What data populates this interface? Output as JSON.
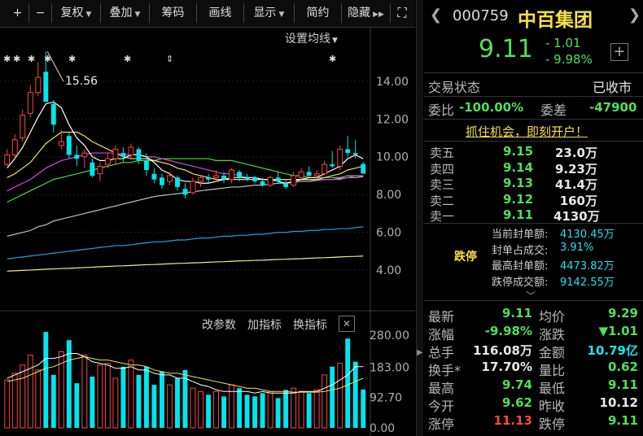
{
  "toolbar": {
    "plus": "+",
    "minus": "−",
    "fuquan": "复权",
    "diejia": "叠加",
    "chouma": "筹码",
    "huaxian": "画线",
    "xianshi": "显示",
    "jianyue": "简约",
    "yincang": "隐藏",
    "fullscreen": "⛶"
  },
  "chart": {
    "ma_settings": "设置均线",
    "high_label": "15.56",
    "y_ticks": [
      "14.00",
      "12.00",
      "10.00",
      "8.00",
      "6.00",
      "4.00"
    ],
    "vol_ticks": [
      "280.00",
      "183.00",
      "92.70",
      "0.00"
    ],
    "vol_buttons": {
      "params": "改参数",
      "add": "加指标",
      "switch": "换指标",
      "close": "✕"
    },
    "colors": {
      "up": "#ff4545",
      "down": "#00e5ee",
      "ma5": "#ffffff",
      "ma10": "#f0e060",
      "ma20": "#e040e0",
      "ma30": "#40e040",
      "ma60": "#c0c0c0",
      "ma120": "#20a0e0",
      "ma250": "#f0f080"
    }
  },
  "chart_data": {
    "type": "candlestick",
    "ylim": [
      2.2,
      16.4
    ],
    "vol_ylim": [
      0,
      300
    ],
    "candles": [
      {
        "o": 9.6,
        "h": 10.4,
        "l": 9.5,
        "c": 10.1,
        "v": 145
      },
      {
        "o": 10.1,
        "h": 11.2,
        "l": 9.9,
        "c": 10.9,
        "v": 165
      },
      {
        "o": 11.0,
        "h": 12.5,
        "l": 10.8,
        "c": 12.2,
        "v": 190
      },
      {
        "o": 12.3,
        "h": 13.8,
        "l": 12.1,
        "c": 13.4,
        "v": 220
      },
      {
        "o": 13.4,
        "h": 15.0,
        "l": 13.2,
        "c": 14.2,
        "v": 175
      },
      {
        "o": 14.5,
        "h": 15.56,
        "l": 13.1,
        "c": 12.9,
        "v": 290
      },
      {
        "o": 12.8,
        "h": 13.0,
        "l": 11.3,
        "c": 11.7,
        "v": 160
      },
      {
        "o": 10.6,
        "h": 11.4,
        "l": 10.4,
        "c": 10.8,
        "v": 230
      },
      {
        "o": 11.1,
        "h": 11.3,
        "l": 9.9,
        "c": 10.1,
        "v": 265
      },
      {
        "o": 10.1,
        "h": 10.6,
        "l": 9.5,
        "c": 9.9,
        "v": 135
      },
      {
        "o": 10.0,
        "h": 10.4,
        "l": 9.4,
        "c": 10.2,
        "v": 220
      },
      {
        "o": 9.7,
        "h": 9.9,
        "l": 8.9,
        "c": 9.0,
        "v": 155
      },
      {
        "o": 9.1,
        "h": 9.7,
        "l": 8.7,
        "c": 9.5,
        "v": 190
      },
      {
        "o": 9.6,
        "h": 10.2,
        "l": 9.4,
        "c": 9.9,
        "v": 195
      },
      {
        "o": 9.9,
        "h": 10.6,
        "l": 9.6,
        "c": 10.4,
        "v": 150
      },
      {
        "o": 10.2,
        "h": 10.5,
        "l": 9.7,
        "c": 10.0,
        "v": 185
      },
      {
        "o": 10.1,
        "h": 10.7,
        "l": 9.9,
        "c": 10.5,
        "v": 205
      },
      {
        "o": 10.4,
        "h": 10.5,
        "l": 9.6,
        "c": 9.8,
        "v": 160
      },
      {
        "o": 9.8,
        "h": 10.2,
        "l": 9.0,
        "c": 9.3,
        "v": 185
      },
      {
        "o": 9.1,
        "h": 9.4,
        "l": 8.6,
        "c": 8.8,
        "v": 130
      },
      {
        "o": 8.9,
        "h": 9.1,
        "l": 8.3,
        "c": 8.5,
        "v": 170
      },
      {
        "o": 8.7,
        "h": 9.2,
        "l": 8.5,
        "c": 9.0,
        "v": 130
      },
      {
        "o": 8.9,
        "h": 9.0,
        "l": 8.2,
        "c": 8.4,
        "v": 150
      },
      {
        "o": 8.3,
        "h": 8.6,
        "l": 7.8,
        "c": 8.0,
        "v": 175
      },
      {
        "o": 8.1,
        "h": 8.9,
        "l": 8.0,
        "c": 8.7,
        "v": 120
      },
      {
        "o": 8.7,
        "h": 9.0,
        "l": 8.4,
        "c": 8.9,
        "v": 110
      },
      {
        "o": 8.9,
        "h": 9.1,
        "l": 8.6,
        "c": 8.8,
        "v": 100
      },
      {
        "o": 8.9,
        "h": 9.3,
        "l": 8.7,
        "c": 9.0,
        "v": 110
      },
      {
        "o": 9.0,
        "h": 9.2,
        "l": 8.6,
        "c": 8.8,
        "v": 95
      },
      {
        "o": 8.8,
        "h": 9.4,
        "l": 8.6,
        "c": 9.3,
        "v": 130
      },
      {
        "o": 9.2,
        "h": 9.3,
        "l": 8.7,
        "c": 8.9,
        "v": 120
      },
      {
        "o": 8.9,
        "h": 9.1,
        "l": 8.7,
        "c": 8.8,
        "v": 100
      },
      {
        "o": 8.9,
        "h": 9.0,
        "l": 8.6,
        "c": 8.7,
        "v": 95
      },
      {
        "o": 8.7,
        "h": 8.9,
        "l": 8.4,
        "c": 8.5,
        "v": 105
      },
      {
        "o": 8.5,
        "h": 9.0,
        "l": 8.4,
        "c": 8.9,
        "v": 110
      },
      {
        "o": 8.9,
        "h": 9.2,
        "l": 8.6,
        "c": 8.7,
        "v": 90
      },
      {
        "o": 8.6,
        "h": 8.8,
        "l": 8.3,
        "c": 8.4,
        "v": 115
      },
      {
        "o": 8.5,
        "h": 9.2,
        "l": 8.4,
        "c": 9.0,
        "v": 120
      },
      {
        "o": 8.9,
        "h": 9.4,
        "l": 8.8,
        "c": 9.2,
        "v": 110
      },
      {
        "o": 9.2,
        "h": 9.5,
        "l": 8.9,
        "c": 9.0,
        "v": 105
      },
      {
        "o": 9.0,
        "h": 9.3,
        "l": 8.8,
        "c": 9.1,
        "v": 115
      },
      {
        "o": 9.1,
        "h": 9.8,
        "l": 9.0,
        "c": 9.6,
        "v": 160
      },
      {
        "o": 9.6,
        "h": 10.3,
        "l": 9.4,
        "c": 9.5,
        "v": 185
      },
      {
        "o": 9.5,
        "h": 10.6,
        "l": 9.3,
        "c": 10.4,
        "v": 195
      },
      {
        "o": 10.4,
        "h": 11.1,
        "l": 10.0,
        "c": 10.2,
        "v": 270
      },
      {
        "o": 10.2,
        "h": 10.9,
        "l": 9.9,
        "c": 10.12,
        "v": 200
      },
      {
        "o": 9.62,
        "h": 9.74,
        "l": 9.11,
        "c": 9.11,
        "v": 116
      }
    ],
    "ma5": [
      9.4,
      9.9,
      10.5,
      11.3,
      12.1,
      12.8,
      12.9,
      12.6,
      11.7,
      11.0,
      10.6,
      10.0,
      9.8,
      9.8,
      9.9,
      9.9,
      10.1,
      10.1,
      10.0,
      9.7,
      9.3,
      9.1,
      8.8,
      8.7,
      8.7,
      8.6,
      8.6,
      8.7,
      8.8,
      8.9,
      8.9,
      8.9,
      8.9,
      8.8,
      8.8,
      8.7,
      8.6,
      8.7,
      8.8,
      8.9,
      8.9,
      9.1,
      9.3,
      9.5,
      9.9,
      10.1,
      9.9
    ],
    "ma10": [
      8.9,
      9.1,
      9.4,
      9.7,
      10.2,
      10.7,
      11.0,
      11.3,
      11.3,
      11.3,
      11.1,
      10.8,
      10.6,
      10.4,
      10.2,
      10.0,
      9.9,
      9.9,
      9.9,
      9.8,
      9.7,
      9.6,
      9.4,
      9.3,
      9.1,
      9.0,
      8.9,
      8.8,
      8.8,
      8.8,
      8.8,
      8.8,
      8.8,
      8.8,
      8.8,
      8.8,
      8.8,
      8.8,
      8.8,
      8.8,
      8.8,
      8.9,
      9.0,
      9.1,
      9.3,
      9.4,
      9.5
    ],
    "ma20": [
      8.2,
      8.4,
      8.6,
      8.8,
      9.1,
      9.4,
      9.6,
      9.8,
      9.9,
      10.0,
      10.1,
      10.2,
      10.2,
      10.2,
      10.2,
      10.1,
      10.1,
      10.1,
      10.0,
      10.0,
      9.9,
      9.8,
      9.7,
      9.6,
      9.5,
      9.4,
      9.3,
      9.2,
      9.1,
      9.1,
      9.0,
      8.9,
      8.9,
      8.8,
      8.8,
      8.8,
      8.8,
      8.8,
      8.8,
      8.8,
      8.8,
      8.8,
      8.8,
      8.8,
      8.9,
      9.0,
      9.0
    ],
    "ma30": [
      7.6,
      7.8,
      8.0,
      8.2,
      8.4,
      8.6,
      8.8,
      8.9,
      9.0,
      9.1,
      9.2,
      9.3,
      9.4,
      9.5,
      9.6,
      9.7,
      9.7,
      9.8,
      9.8,
      9.8,
      9.9,
      9.9,
      9.9,
      9.9,
      9.9,
      9.9,
      9.9,
      9.8,
      9.8,
      9.8,
      9.7,
      9.6,
      9.5,
      9.4,
      9.3,
      9.2,
      9.1,
      9.0,
      9.0,
      8.9,
      8.9,
      8.9,
      8.9,
      8.9,
      9.0,
      9.0,
      9.0
    ],
    "ma60": [
      5.8,
      5.9,
      6.0,
      6.1,
      6.3,
      6.4,
      6.6,
      6.7,
      6.8,
      6.9,
      7.0,
      7.1,
      7.2,
      7.3,
      7.4,
      7.5,
      7.6,
      7.7,
      7.8,
      7.9,
      7.95,
      8.0,
      8.05,
      8.1,
      8.15,
      8.2,
      8.25,
      8.3,
      8.35,
      8.4,
      8.4,
      8.45,
      8.5,
      8.5,
      8.55,
      8.6,
      8.6,
      8.65,
      8.7,
      8.7,
      8.75,
      8.8,
      8.8,
      8.85,
      8.9,
      8.9,
      8.95
    ],
    "ma120": [
      4.6,
      4.65,
      4.7,
      4.75,
      4.8,
      4.85,
      4.9,
      4.95,
      5.0,
      5.05,
      5.1,
      5.15,
      5.2,
      5.25,
      5.3,
      5.3,
      5.35,
      5.4,
      5.45,
      5.5,
      5.5,
      5.55,
      5.6,
      5.6,
      5.65,
      5.7,
      5.7,
      5.75,
      5.8,
      5.8,
      5.85,
      5.85,
      5.9,
      5.9,
      5.95,
      6.0,
      6.0,
      6.05,
      6.05,
      6.1,
      6.1,
      6.15,
      6.15,
      6.2,
      6.2,
      6.25,
      6.3
    ],
    "ma250": [
      3.95,
      3.97,
      3.99,
      4.01,
      4.03,
      4.05,
      4.07,
      4.09,
      4.1,
      4.12,
      4.14,
      4.16,
      4.18,
      4.2,
      4.22,
      4.23,
      4.25,
      4.27,
      4.29,
      4.3,
      4.32,
      4.34,
      4.36,
      4.37,
      4.39,
      4.4,
      4.42,
      4.44,
      4.45,
      4.47,
      4.49,
      4.5,
      4.52,
      4.53,
      4.55,
      4.57,
      4.58,
      4.6,
      4.61,
      4.63,
      4.65,
      4.66,
      4.68,
      4.7,
      4.72,
      4.73,
      4.75
    ],
    "vol_ma5": [
      150,
      160,
      170,
      180,
      190,
      210,
      210,
      215,
      225,
      225,
      215,
      200,
      195,
      190,
      180,
      180,
      185,
      175,
      175,
      165,
      160,
      160,
      150,
      150,
      140,
      130,
      125,
      115,
      110,
      110,
      110,
      110,
      105,
      110,
      105,
      105,
      105,
      105,
      110,
      110,
      110,
      120,
      130,
      145,
      160,
      185,
      185
    ],
    "vol_ma10": [
      140,
      145,
      150,
      160,
      170,
      180,
      185,
      195,
      205,
      210,
      215,
      210,
      205,
      205,
      200,
      195,
      190,
      190,
      185,
      175,
      170,
      165,
      165,
      160,
      155,
      150,
      145,
      140,
      135,
      130,
      125,
      120,
      120,
      115,
      110,
      110,
      110,
      108,
      108,
      108,
      108,
      110,
      115,
      120,
      130,
      140,
      150
    ]
  },
  "quote": {
    "code": "000759",
    "name": "中百集团",
    "price": "9.11",
    "change": "- 1.01",
    "pct": "- 9.98%",
    "add": "+",
    "status_label": "交易状态",
    "status_value": "已收市",
    "weibi_label": "委比",
    "weibi_value": "-100.00%",
    "weicha_label": "委差",
    "weicha_value": "-47900",
    "promo": "抓住机会，即刻开户！",
    "asks": [
      {
        "label": "卖五",
        "price": "9.15",
        "vol": "23.0万"
      },
      {
        "label": "卖四",
        "price": "9.14",
        "vol": "9.23万"
      },
      {
        "label": "卖三",
        "price": "9.13",
        "vol": "41.4万"
      },
      {
        "label": "卖二",
        "price": "9.12",
        "vol": "160万"
      },
      {
        "label": "卖一",
        "price": "9.11",
        "vol": "4130万"
      }
    ],
    "limit_tag": "跌停",
    "limit_lines": [
      {
        "label": "当前封单额:",
        "value": "4130.45万"
      },
      {
        "label": "封单占成交:",
        "value": "3.91%"
      },
      {
        "label": "最高封单额:",
        "value": "4473.82万"
      },
      {
        "label": "跌停成交额:",
        "value": "9142.55万"
      }
    ],
    "stats": [
      {
        "l1": "最新",
        "v1": "9.11",
        "c1": "green",
        "l2": "均价",
        "v2": "9.29",
        "c2": "green"
      },
      {
        "l1": "涨幅",
        "v1": "-9.98%",
        "c1": "green",
        "l2": "涨跌",
        "v2": "▼1.01",
        "c2": "green"
      },
      {
        "l1": "总手",
        "v1": "116.08万",
        "c1": "white",
        "l2": "金额",
        "v2": "10.79亿",
        "c2": "cyan"
      },
      {
        "l1": "换手*",
        "v1": "17.70%",
        "c1": "white",
        "l2": "量比",
        "v2": "0.62",
        "c2": "green"
      },
      {
        "l1": "最高",
        "v1": "9.74",
        "c1": "green",
        "l2": "最低",
        "v2": "9.11",
        "c2": "green"
      },
      {
        "l1": "今开",
        "v1": "9.62",
        "c1": "green",
        "l2": "昨收",
        "v2": "10.12",
        "c2": "white"
      },
      {
        "l1": "涨停",
        "v1": "11.13",
        "c1": "red",
        "l2": "跌停",
        "v2": "9.11",
        "c2": "green"
      }
    ]
  }
}
